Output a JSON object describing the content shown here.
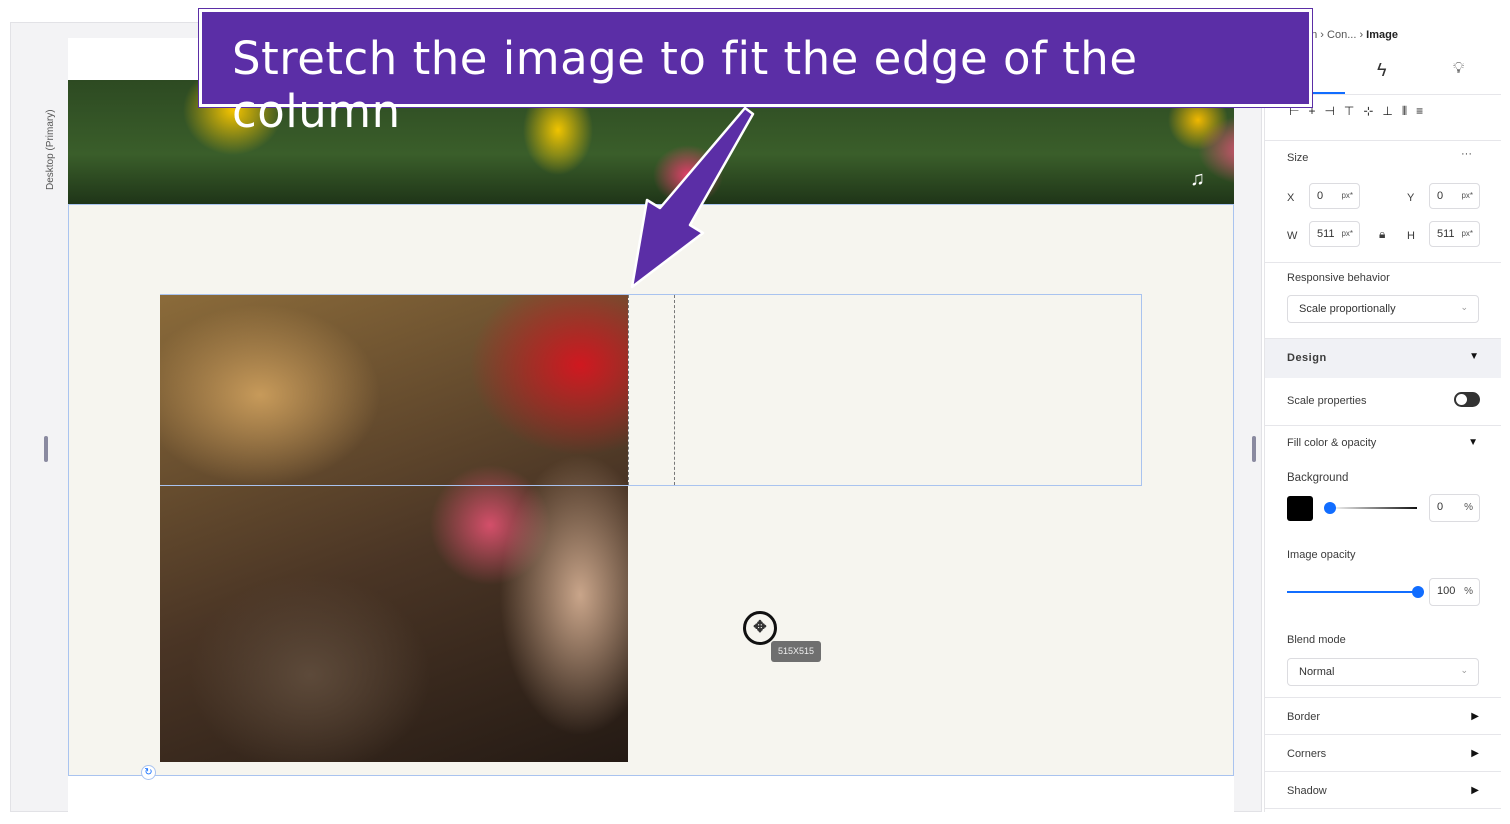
{
  "canvas": {
    "viewport_label": "Desktop (Primary)",
    "size_tooltip": "515X515"
  },
  "callout": {
    "text": "Stretch the image to fit the edge of the column",
    "color": "#5b2ea6"
  },
  "panel": {
    "breadcrumb": [
      "on",
      "Con...",
      "Image"
    ],
    "tabs": [
      {
        "icon": "design-tab"
      },
      {
        "icon": "lightning-icon"
      },
      {
        "icon": "lightbulb-icon"
      }
    ],
    "size": {
      "label": "Size",
      "more": "···",
      "x": "0",
      "y": "0",
      "w": "511",
      "h": "511",
      "unit": "px*",
      "x_label": "X",
      "y_label": "Y",
      "w_label": "W",
      "h_label": "H"
    },
    "responsive": {
      "label": "Responsive behavior",
      "value": "Scale proportionally"
    },
    "design": {
      "label": "Design"
    },
    "scale_properties": {
      "label": "Scale properties",
      "on": false
    },
    "fill": {
      "label": "Fill color & opacity",
      "background_label": "Background",
      "color": "#000000",
      "opacity": "0",
      "unit": "%"
    },
    "image_opacity": {
      "label": "Image opacity",
      "value": "100",
      "unit": "%"
    },
    "blend": {
      "label": "Blend mode",
      "value": "Normal"
    },
    "sections": [
      "Border",
      "Corners",
      "Shadow"
    ],
    "accent": "#116dff"
  }
}
